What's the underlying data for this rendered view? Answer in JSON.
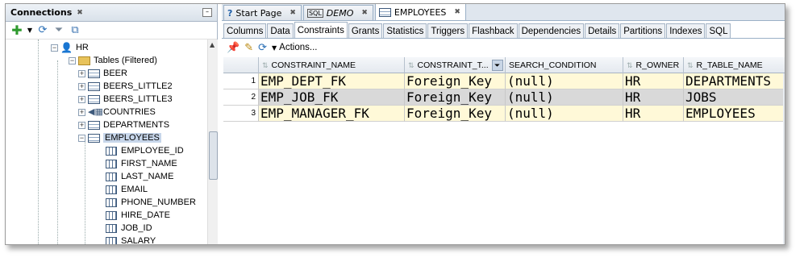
{
  "connections": {
    "title": "Connections",
    "tree": [
      {
        "label": "HR",
        "kind": "user"
      },
      {
        "label": "Tables (Filtered)",
        "kind": "folder"
      },
      {
        "label": "BEER",
        "kind": "table"
      },
      {
        "label": "BEERS_LITTLE2",
        "kind": "table"
      },
      {
        "label": "BEERS_LITTLE3",
        "kind": "table"
      },
      {
        "label": "COUNTRIES",
        "kind": "view"
      },
      {
        "label": "DEPARTMENTS",
        "kind": "table"
      },
      {
        "label": "EMPLOYEES",
        "kind": "table",
        "selected": true
      },
      {
        "label": "EMPLOYEE_ID",
        "kind": "column"
      },
      {
        "label": "FIRST_NAME",
        "kind": "column"
      },
      {
        "label": "LAST_NAME",
        "kind": "column"
      },
      {
        "label": "EMAIL",
        "kind": "column"
      },
      {
        "label": "PHONE_NUMBER",
        "kind": "column"
      },
      {
        "label": "HIRE_DATE",
        "kind": "column"
      },
      {
        "label": "JOB_ID",
        "kind": "column"
      },
      {
        "label": "SALARY",
        "kind": "column"
      }
    ]
  },
  "editor_tabs": [
    {
      "label": "Start Page",
      "icon": "help-icon"
    },
    {
      "label": "DEMO",
      "icon": "sql-worksheet-icon",
      "italic": true
    },
    {
      "label": "EMPLOYEES",
      "icon": "table-icon",
      "active": true
    }
  ],
  "sub_tabs": [
    {
      "label": "Columns"
    },
    {
      "label": "Data"
    },
    {
      "label": "Constraints",
      "active": true
    },
    {
      "label": "Grants"
    },
    {
      "label": "Statistics"
    },
    {
      "label": "Triggers"
    },
    {
      "label": "Flashback"
    },
    {
      "label": "Dependencies"
    },
    {
      "label": "Details"
    },
    {
      "label": "Partitions"
    },
    {
      "label": "Indexes"
    },
    {
      "label": "SQL"
    }
  ],
  "actions_label": "Actions...",
  "grid": {
    "columns": [
      "CONSTRAINT_NAME",
      "CONSTRAINT_T...",
      "SEARCH_CONDITION",
      "R_OWNER",
      "R_TABLE_NAME"
    ],
    "rows": [
      {
        "num": "1",
        "cells": [
          "EMP_DEPT_FK",
          "Foreign_Key",
          "(null)",
          "HR",
          "DEPARTMENTS"
        ]
      },
      {
        "num": "2",
        "cells": [
          "EMP_JOB_FK",
          "Foreign_Key",
          "(null)",
          "HR",
          "JOBS"
        ]
      },
      {
        "num": "3",
        "cells": [
          "EMP_MANAGER_FK",
          "Foreign_Key",
          "(null)",
          "HR",
          "EMPLOYEES"
        ]
      }
    ]
  }
}
